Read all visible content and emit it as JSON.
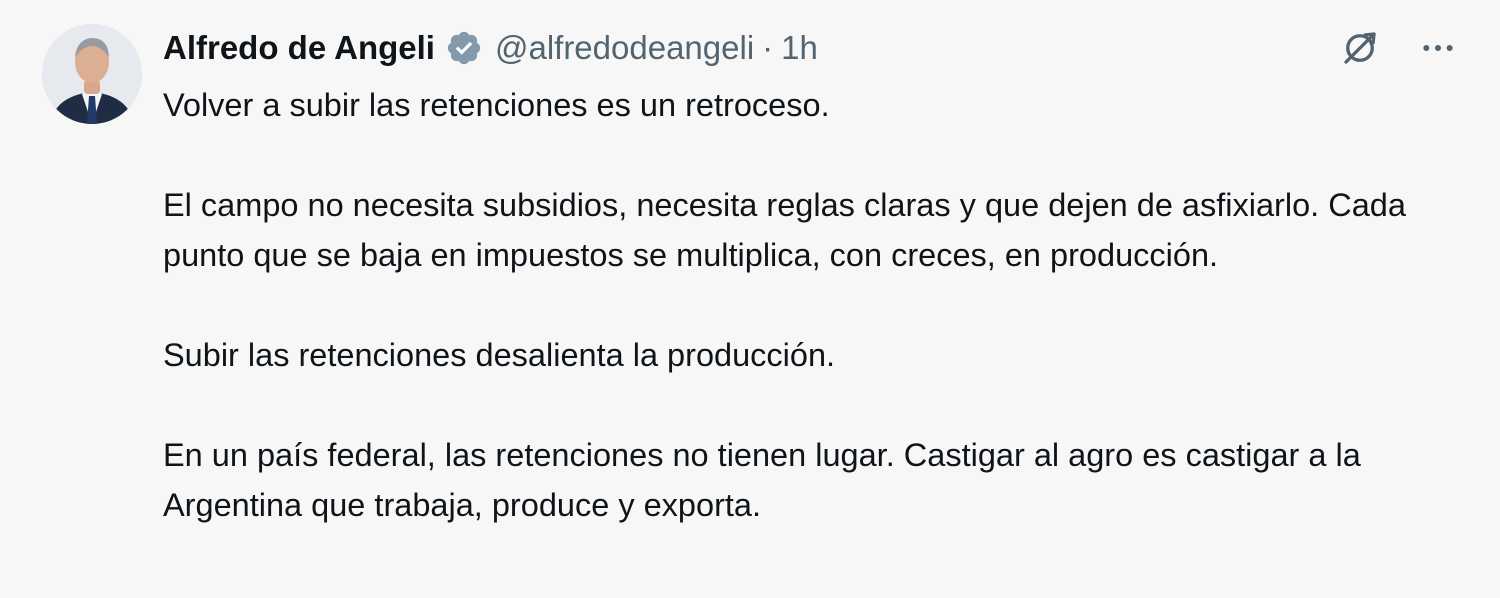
{
  "author": {
    "name": "Alfredo de Angeli",
    "handle": "@alfredodeangeli",
    "separator": "·",
    "time": "1h",
    "avatar_icon": "profile-photo",
    "verified_icon": "verified-badge-icon",
    "verified_color": "#829aab"
  },
  "actions": {
    "grok_icon": "grok-icon",
    "more_icon": "more-options-icon",
    "icon_color": "#536471"
  },
  "tweet": {
    "paragraphs": [
      "Volver a subir las retenciones es un retroceso.",
      "El campo no necesita subsidios, necesita reglas claras y que dejen de asfixiarlo. Cada punto que se baja en impuestos se multiplica, con creces, en producción.",
      "Subir las retenciones desalienta la producción.",
      "En un país federal, las retenciones no tienen lugar. Castigar al agro es castigar a la Argentina que trabaja, produce y exporta."
    ]
  }
}
